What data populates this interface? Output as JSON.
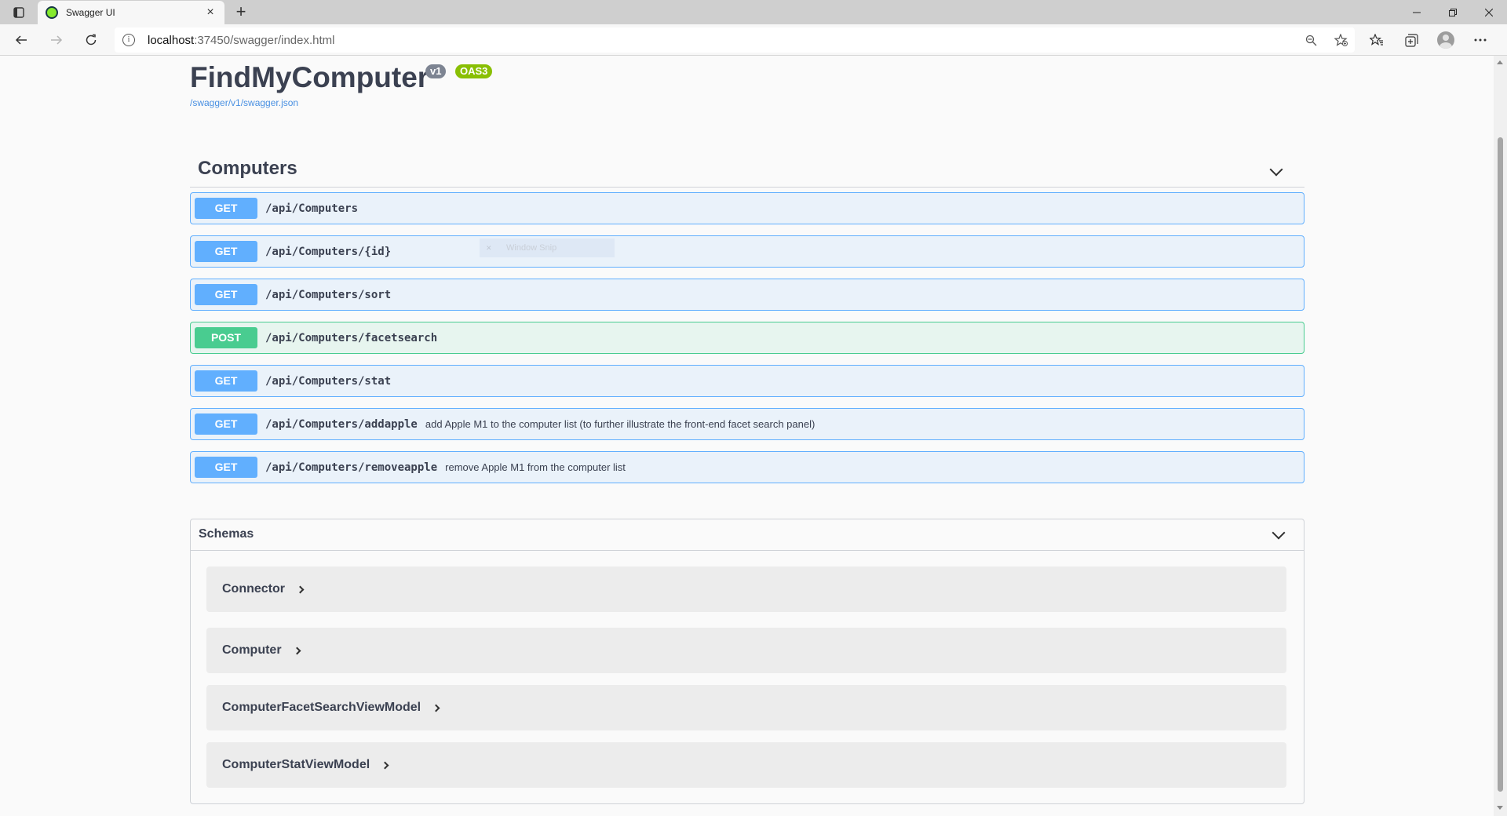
{
  "browser": {
    "tab_title": "Swagger UI",
    "tab_close": "×",
    "new_tab": "+",
    "url_host": "localhost",
    "url_path": ":37450/swagger/index.html"
  },
  "api": {
    "title": "FindMyComputer",
    "version_badge": "v1",
    "oas_badge": "OAS3",
    "spec_link": "/swagger/v1/swagger.json"
  },
  "section": {
    "title": "Computers"
  },
  "operations": [
    {
      "method": "GET",
      "path": "/api/Computers",
      "summary": ""
    },
    {
      "method": "GET",
      "path": "/api/Computers/{id}",
      "summary": ""
    },
    {
      "method": "GET",
      "path": "/api/Computers/sort",
      "summary": ""
    },
    {
      "method": "POST",
      "path": "/api/Computers/facetsearch",
      "summary": ""
    },
    {
      "method": "GET",
      "path": "/api/Computers/stat",
      "summary": ""
    },
    {
      "method": "GET",
      "path": "/api/Computers/addapple",
      "summary": "add Apple M1 to the computer list (to further illustrate the front-end facet search panel)"
    },
    {
      "method": "GET",
      "path": "/api/Computers/removeapple",
      "summary": "remove Apple M1 from the computer list"
    }
  ],
  "overlay": {
    "label": "Window Snip"
  },
  "schemas": {
    "title": "Schemas",
    "models": [
      "Connector",
      "Computer",
      "ComputerFacetSearchViewModel",
      "ComputerStatViewModel"
    ]
  }
}
